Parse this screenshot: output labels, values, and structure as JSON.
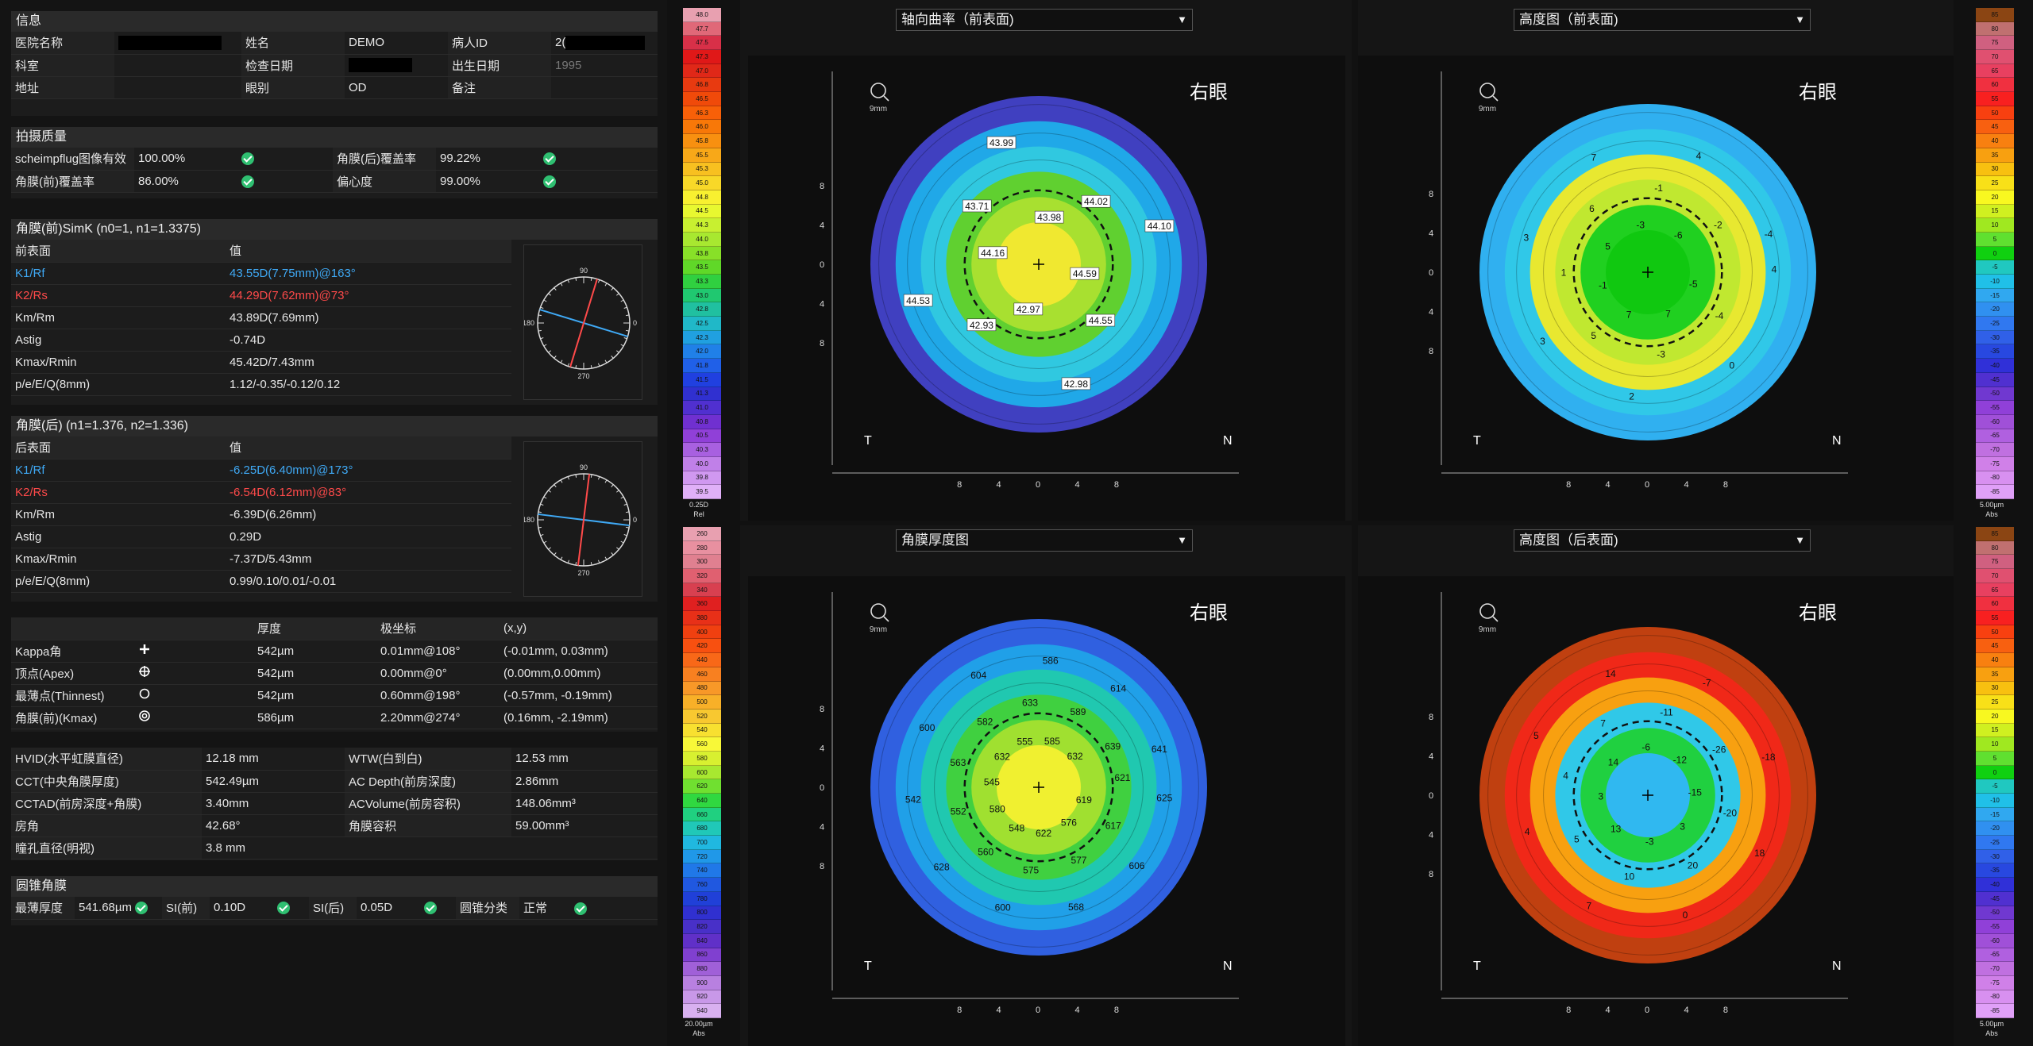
{
  "info": {
    "title": "信息",
    "rows": [
      [
        "医院名称",
        "",
        "姓名",
        "DEMO",
        "病人ID",
        "2("
      ],
      [
        "科室",
        "",
        "检查日期",
        "",
        "出生日期",
        "1995"
      ],
      [
        "地址",
        "",
        "眼别",
        "OD",
        "备注",
        ""
      ]
    ]
  },
  "quality": {
    "title": "拍摄质量",
    "rows": [
      [
        "scheimpflug图像有效",
        "100.00%",
        "角膜(后)覆盖率",
        "99.22%"
      ],
      [
        "角膜(前)覆盖率",
        "86.00%",
        "偏心度",
        "99.00%"
      ]
    ]
  },
  "front": {
    "title": "角膜(前)SimK (n0=1, n1=1.3375)",
    "col1": "前表面",
    "col2": "值",
    "rows": [
      [
        "K1/Rf",
        "43.55D(7.75mm)@163°"
      ],
      [
        "K2/Rs",
        "44.29D(7.62mm)@73°"
      ],
      [
        "Km/Rm",
        "43.89D(7.69mm)"
      ],
      [
        "Astig",
        "-0.74D"
      ],
      [
        "Kmax/Rmin",
        "45.42D/7.43mm"
      ],
      [
        "p/e/E/Q(8mm)",
        "1.12/-0.35/-0.12/0.12"
      ]
    ],
    "dial": {
      "top": "90",
      "left": "180",
      "right": "0",
      "bottom": "270",
      "k1_angle": 163,
      "k2_angle": 73
    }
  },
  "back": {
    "title": "角膜(后) (n1=1.376, n2=1.336)",
    "col1": "后表面",
    "col2": "值",
    "rows": [
      [
        "K1/Rf",
        "-6.25D(6.40mm)@173°"
      ],
      [
        "K2/Rs",
        "-6.54D(6.12mm)@83°"
      ],
      [
        "Km/Rm",
        "-6.39D(6.26mm)"
      ],
      [
        "Astig",
        "0.29D"
      ],
      [
        "Kmax/Rmin",
        "-7.37D/5.43mm"
      ],
      [
        "p/e/E/Q(8mm)",
        "0.99/0.10/0.01/-0.01"
      ]
    ],
    "dial": {
      "top": "90",
      "left": "180",
      "right": "0",
      "bottom": "270",
      "k1_angle": 173,
      "k2_angle": 83
    }
  },
  "points": {
    "headers": [
      "",
      "",
      "厚度",
      "极坐标",
      "(x,y)"
    ],
    "rows": [
      {
        "name": "Kappa角",
        "icon": "plus-icon",
        "t": "542µm",
        "p": "0.01mm@108°",
        "xy": "(-0.01mm, 0.03mm)"
      },
      {
        "name": "顶点(Apex)",
        "icon": "crosshair-icon",
        "t": "542µm",
        "p": "0.00mm@0°",
        "xy": "(0.00mm,0.00mm)"
      },
      {
        "name": "最薄点(Thinnest)",
        "icon": "circle-icon",
        "t": "542µm",
        "p": "0.60mm@198°",
        "xy": "(-0.57mm, -0.19mm)"
      },
      {
        "name": "角膜(前)(Kmax)",
        "icon": "target-icon",
        "t": "586µm",
        "p": "2.20mm@274°",
        "xy": "(0.16mm, -2.19mm)"
      }
    ]
  },
  "measure": {
    "rows": [
      [
        "HVID(水平虹膜直径)",
        "12.18 mm",
        "WTW(白到白)",
        "12.53 mm"
      ],
      [
        "CCT(中央角膜厚度)",
        "542.49µm",
        "AC Depth(前房深度)",
        "2.86mm"
      ],
      [
        "CCTAD(前房深度+角膜)",
        "3.40mm",
        "ACVolume(前房容积)",
        "148.06mm³"
      ],
      [
        "房角",
        "42.68°",
        "角膜容积",
        "59.00mm³"
      ],
      [
        "瞳孔直径(明视)",
        "3.8 mm",
        "",
        ""
      ]
    ]
  },
  "kc": {
    "title": "圆锥角膜",
    "items": [
      [
        "最薄厚度",
        "541.68µm"
      ],
      [
        "SI(前)",
        "0.10D"
      ],
      [
        "SI(后)",
        "0.05D"
      ],
      [
        "圆锥分类",
        "正常"
      ]
    ]
  },
  "scales": {
    "axial": {
      "values": [
        "48.0",
        "47.7",
        "47.5",
        "47.3",
        "47.0",
        "46.8",
        "46.5",
        "46.3",
        "46.0",
        "45.8",
        "45.5",
        "45.3",
        "45.0",
        "44.8",
        "44.5",
        "44.3",
        "44.0",
        "43.8",
        "43.5",
        "43.3",
        "43.0",
        "42.8",
        "42.5",
        "42.3",
        "42.0",
        "41.8",
        "41.5",
        "41.3",
        "41.0",
        "40.8",
        "40.5",
        "40.3",
        "40.0",
        "39.8",
        "39.5"
      ],
      "foot1": "0.25D",
      "foot2": "Rel"
    },
    "elev": {
      "values": [
        "85",
        "80",
        "75",
        "70",
        "65",
        "60",
        "55",
        "50",
        "45",
        "40",
        "35",
        "30",
        "25",
        "20",
        "15",
        "10",
        "5",
        "0",
        "-5",
        "-10",
        "-15",
        "-20",
        "-25",
        "-30",
        "-35",
        "-40",
        "-45",
        "-50",
        "-55",
        "-60",
        "-65",
        "-70",
        "-75",
        "-80",
        "-85"
      ],
      "foot1": "5.00µm",
      "foot2": "Abs"
    },
    "thick": {
      "values": [
        "260",
        "280",
        "300",
        "320",
        "340",
        "360",
        "380",
        "400",
        "420",
        "440",
        "460",
        "480",
        "500",
        "520",
        "540",
        "560",
        "580",
        "600",
        "620",
        "640",
        "660",
        "680",
        "700",
        "720",
        "740",
        "760",
        "780",
        "800",
        "820",
        "840",
        "860",
        "880",
        "900",
        "920",
        "940"
      ],
      "foot1": "20.00µm",
      "foot2": "Abs"
    },
    "elev2": {
      "values": [
        "85",
        "80",
        "75",
        "70",
        "65",
        "60",
        "55",
        "50",
        "45",
        "40",
        "35",
        "30",
        "25",
        "20",
        "15",
        "10",
        "5",
        "0",
        "-5",
        "-10",
        "-15",
        "-20",
        "-25",
        "-30",
        "-35",
        "-40",
        "-45",
        "-50",
        "-55",
        "-60",
        "-65",
        "-70",
        "-75",
        "-80",
        "-85"
      ],
      "foot1": "5.00µm",
      "foot2": "Abs"
    }
  },
  "maps": [
    {
      "select": "轴向曲率（前表面)",
      "eye": "右眼",
      "mag": "9mm"
    },
    {
      "select": "高度图（前表面)",
      "eye": "右眼",
      "mag": "9mm"
    },
    {
      "select": "角膜厚度图",
      "eye": "右眼",
      "mag": "9mm"
    },
    {
      "select": "高度图（后表面)",
      "eye": "右眼",
      "mag": "9mm"
    }
  ],
  "map_common": {
    "t": "T",
    "n": "N",
    "xticks": [
      "8",
      "4",
      "0",
      "4",
      "8"
    ],
    "yticks": [
      "8",
      "4",
      "0",
      "4",
      "8"
    ]
  },
  "axial_labels": [
    "44.10",
    "44.02",
    "43.98",
    "43.99",
    "43.71",
    "44.16",
    "44.53",
    "42.93",
    "42.97",
    "42.98",
    "44.55",
    "44.59"
  ],
  "elev_labels": [
    "-4",
    "-2",
    "-6",
    "4",
    "-1",
    "-3",
    "7",
    "6",
    "5",
    "3",
    "1",
    "-1",
    "3",
    "5",
    "7",
    "2",
    "-3",
    "7",
    "0",
    "-4",
    "-5",
    "4"
  ],
  "thick_labels": [
    "641",
    "639",
    "632",
    "614",
    "589",
    "585",
    "586",
    "633",
    "555",
    "604",
    "582",
    "632",
    "600",
    "563",
    "545",
    "542",
    "552",
    "580",
    "628",
    "560",
    "548",
    "600",
    "575",
    "622",
    "568",
    "577",
    "576",
    "606",
    "617",
    "619",
    "625",
    "621"
  ],
  "elev2_labels": [
    "-18",
    "-26",
    "-12",
    "-7",
    "-11",
    "-6",
    "14",
    "7",
    "14",
    "5",
    "4",
    "3",
    "4",
    "5",
    "13",
    "7",
    "10",
    "-3",
    "0",
    "20",
    "3",
    "18",
    "-20",
    "-15"
  ],
  "colors": {
    "accent_blue": "#3fa9f5",
    "accent_red": "#ff4a4a",
    "check": "#2fbf71"
  }
}
